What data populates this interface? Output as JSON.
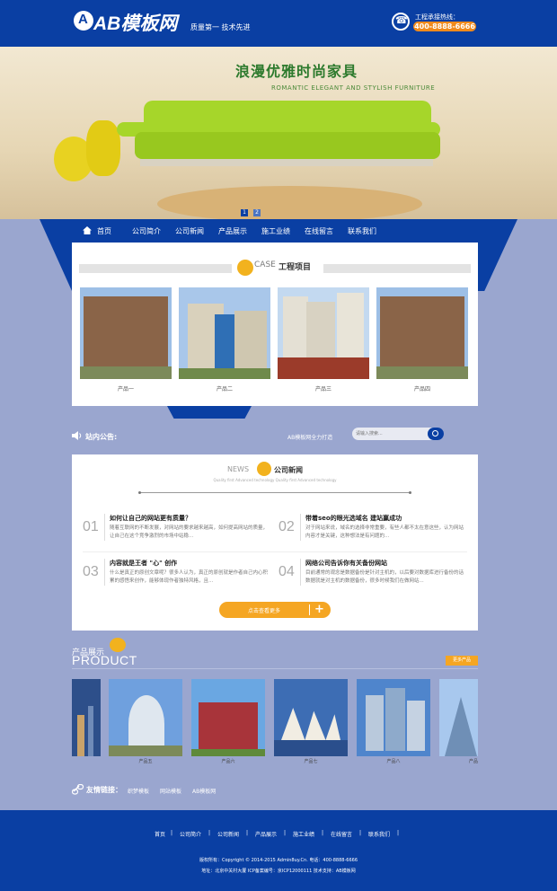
{
  "header": {
    "logo_text": "AB模板网",
    "slogan": "质量第一 技术先进",
    "hotline_label": "工程承接热线：",
    "hotline_number": "400-8888-6666"
  },
  "banner": {
    "title": "浪漫优雅时尚家具",
    "subtitle": "ROMANTIC ELEGANT AND STYLISH FURNITURE",
    "pages": [
      "1",
      "2"
    ]
  },
  "nav": {
    "items": [
      "首页",
      "公司简介",
      "公司新闻",
      "产品展示",
      "施工业绩",
      "在线留言",
      "联系我们"
    ]
  },
  "cases": {
    "en": "CASE",
    "title": "工程项目",
    "items": [
      "产品一",
      "产品二",
      "产品三",
      "产品四"
    ]
  },
  "announce": {
    "title": "站内公告:",
    "text": "AB模板网全力打造",
    "search_placeholder": "请输入搜索..."
  },
  "news": {
    "en": "NEWS",
    "title": "公司新闻",
    "sub": "Quality first Advanced technology Quality first Advanced technology",
    "items": [
      {
        "num": "01",
        "title": "如何让自己的网站更有质量？",
        "text": "随着互联网的不断发展，对网站的要求越来越高，如何提高网站的质量，让自己在这个竞争激烈的市场中站稳..."
      },
      {
        "num": "02",
        "title": "带着seo的眼光选域名 建站赢成功",
        "text": "对于网站来说，域名的选择非常重要，有些人都不太在意这些，认为网站内容才是关键，这种想法是有问题的..."
      },
      {
        "num": "03",
        "title": "内容就是王者 \"心\" 创作",
        "text": "什么是真正的原创文章呢？很多人认为，真正的原创就是作者自己内心积累的感悟来创作，能够体现作者独特风格，且..."
      },
      {
        "num": "04",
        "title": "网络公司告诉你有关备份网站",
        "text": "目前通常的观念是数据备份是针对主机的，以后要对数据库进行备份的话数据就是对主机的数据备份，很多时候我们在做网站..."
      }
    ],
    "more": "点击查看更多"
  },
  "product": {
    "cn": "产品展示",
    "en": "PRODUCT",
    "more": "更多产品",
    "items": [
      "产品五",
      "产品六",
      "产品七",
      "产品八"
    ],
    "partial_right": "产品"
  },
  "links": {
    "title": "友情链接：",
    "items": [
      "织梦模板",
      "网站模板",
      "AB模板网"
    ]
  },
  "footer": {
    "nav": [
      "首页",
      "公司简介",
      "公司新闻",
      "产品展示",
      "施工业绩",
      "在线留言",
      "联系我们"
    ],
    "copyright": "版权所有：Copyright © 2014-2015 Admin8uy.Cn.    电话：400-8888-6666",
    "address": "地址：北京中关村大厦    ICP备案编号：京ICP12000111    技术支持：AB模板网"
  }
}
